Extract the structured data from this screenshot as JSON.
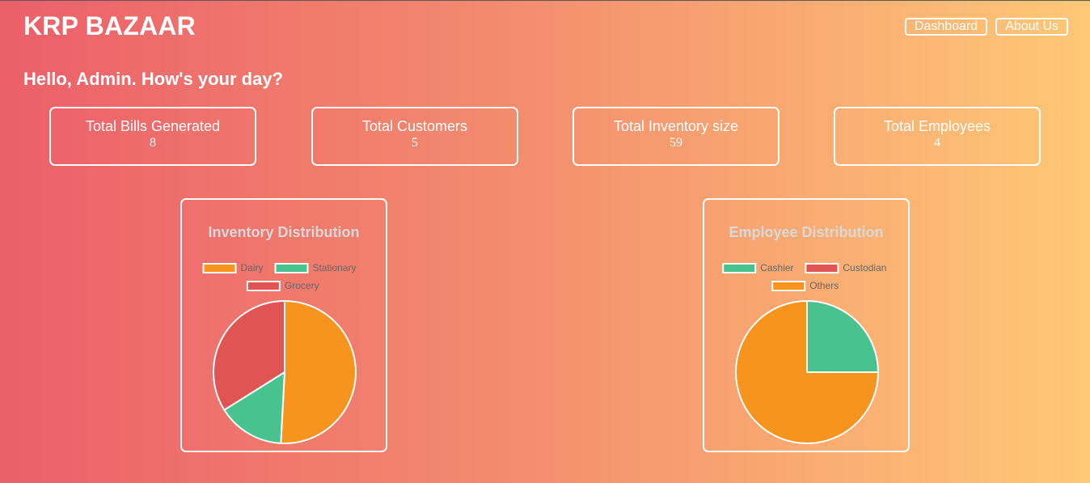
{
  "header": {
    "brand": "KRP BAZAAR",
    "nav": [
      "Dashboard",
      "About Us"
    ]
  },
  "greeting": "Hello, Admin. How's your day?",
  "stats": [
    {
      "label": "Total Bills Generated",
      "value": "8"
    },
    {
      "label": "Total Customers",
      "value": "5"
    },
    {
      "label": "Total Inventory size",
      "value": "59"
    },
    {
      "label": "Total Employees",
      "value": "4"
    }
  ],
  "colors": {
    "orange": "#f7941e",
    "green": "#48c38f",
    "red": "#e05454"
  },
  "chart_data": [
    {
      "type": "pie",
      "title": "Inventory Distribution",
      "categories": [
        "Dairy",
        "Stationary",
        "Grocery"
      ],
      "values": [
        30,
        9,
        20
      ],
      "colors": [
        "#f7941e",
        "#48c38f",
        "#e05454"
      ],
      "legend": "top"
    },
    {
      "type": "pie",
      "title": "Employee Distribution",
      "categories": [
        "Cashier",
        "Custodian",
        "Others"
      ],
      "values": [
        1,
        0,
        3
      ],
      "colors": [
        "#48c38f",
        "#e05454",
        "#f7941e"
      ],
      "legend": "top"
    }
  ]
}
